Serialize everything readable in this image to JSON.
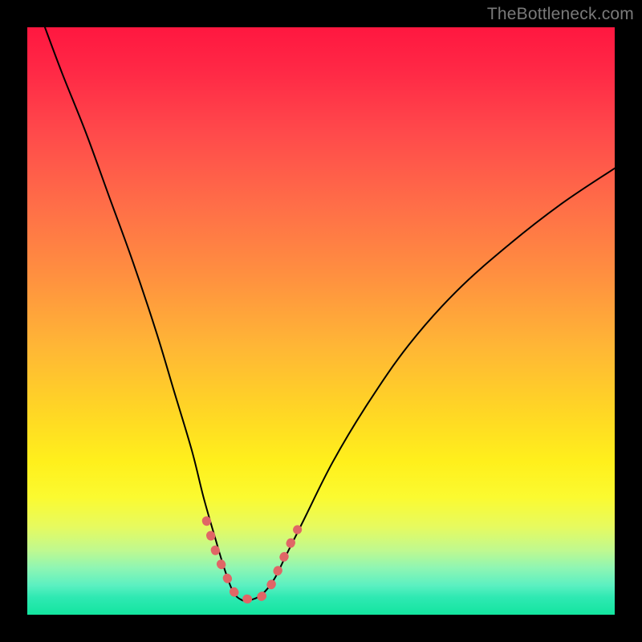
{
  "watermark": "TheBottleneck.com",
  "chart_data": {
    "type": "line",
    "title": "",
    "xlabel": "",
    "ylabel": "",
    "xlim": [
      0,
      100
    ],
    "ylim": [
      0,
      100
    ],
    "series": [
      {
        "name": "bottleneck-curve",
        "x": [
          3,
          6,
          10,
          14,
          18,
          22,
          25,
          28,
          30,
          32,
          33.5,
          35,
          36.5,
          38,
          40,
          42,
          44,
          47,
          52,
          58,
          65,
          73,
          82,
          91,
          100
        ],
        "y": [
          100,
          92,
          82,
          71,
          60,
          48,
          38,
          28,
          20,
          13,
          8,
          4,
          2.5,
          2.5,
          3.5,
          6,
          10,
          16,
          26,
          36,
          46,
          55,
          63,
          70,
          76
        ],
        "color": "#000000",
        "stroke_width": 2
      },
      {
        "name": "highlight-segment",
        "x": [
          30.5,
          32,
          33.5,
          35,
          36,
          37,
          38,
          39,
          40,
          41,
          42,
          43,
          44.5,
          46
        ],
        "y": [
          16,
          11,
          7.5,
          4.2,
          3.2,
          2.8,
          2.6,
          2.7,
          3.2,
          4.3,
          6,
          8.3,
          11.5,
          14.5
        ],
        "color": "#e06666",
        "stroke_width": 11,
        "dashed": true
      }
    ],
    "background": {
      "type": "vertical-gradient",
      "stops": [
        {
          "pos": 0.0,
          "color": "#ff1740"
        },
        {
          "pos": 0.3,
          "color": "#ff6d48"
        },
        {
          "pos": 0.66,
          "color": "#ffd824"
        },
        {
          "pos": 0.85,
          "color": "#e7fa5f"
        },
        {
          "pos": 1.0,
          "color": "#13e59f"
        }
      ]
    }
  }
}
